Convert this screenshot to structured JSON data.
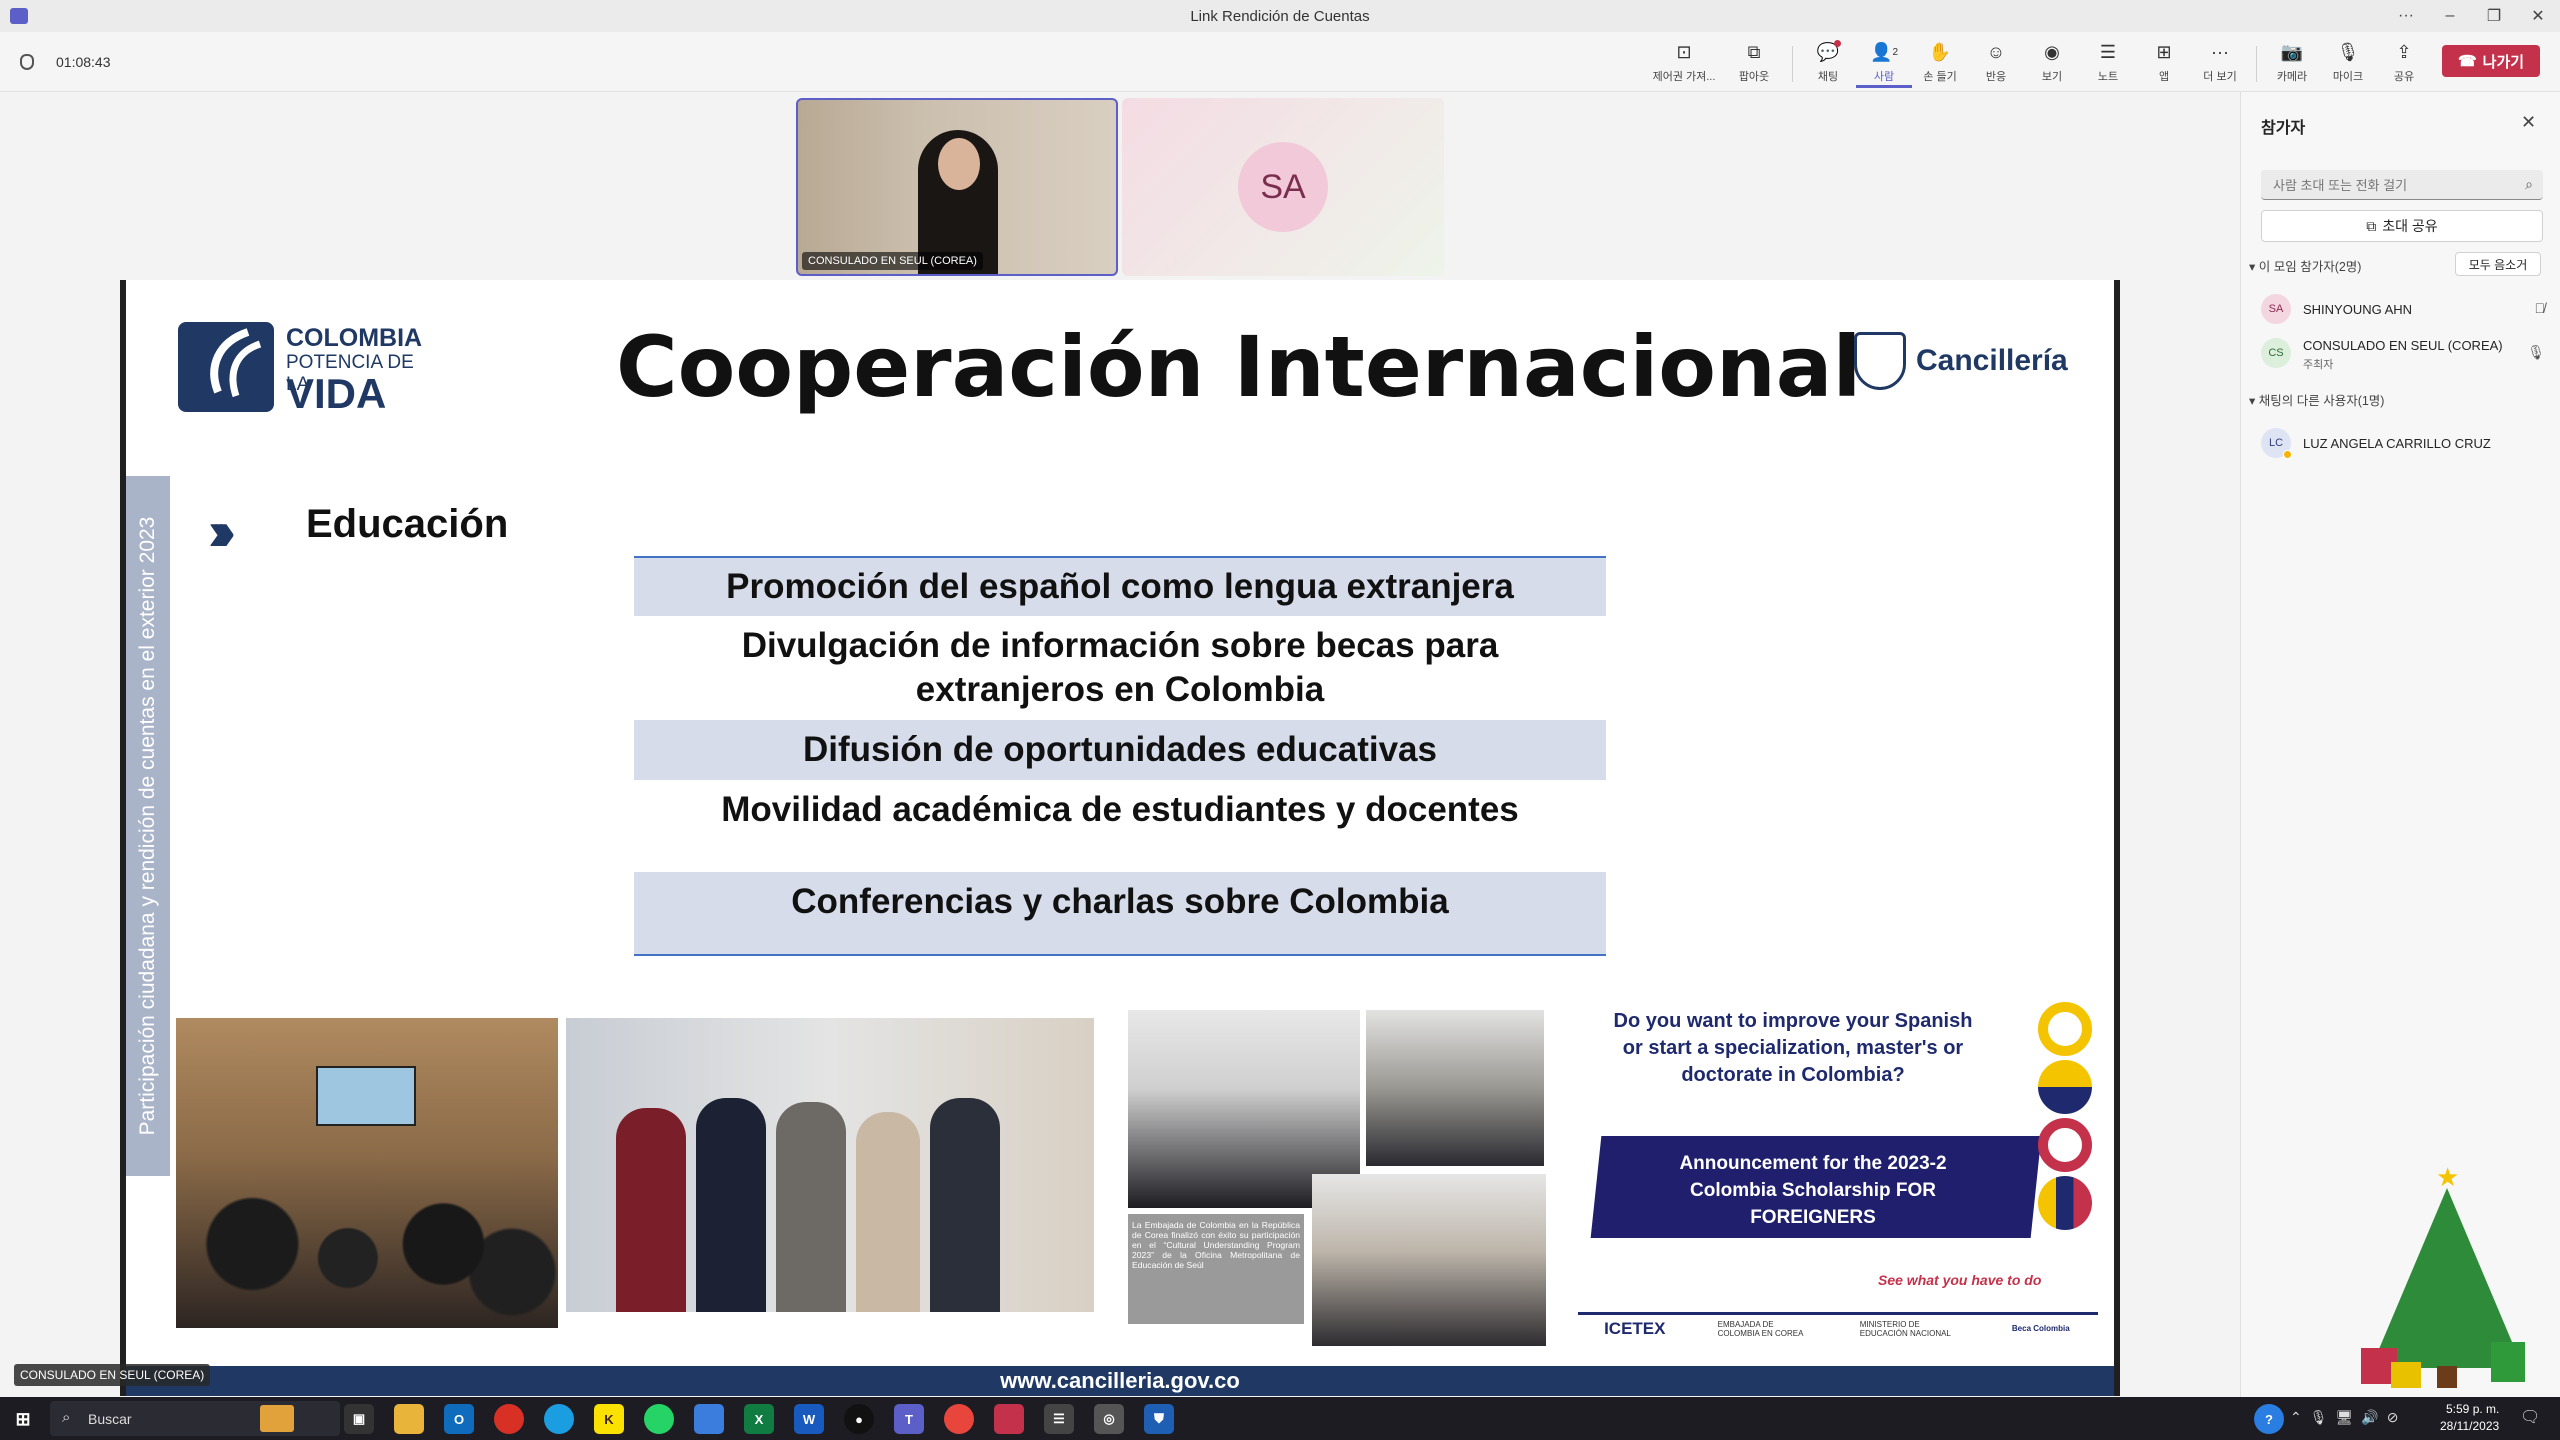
{
  "window": {
    "title": "Link Rendición de Cuentas",
    "more": "···",
    "min": "–",
    "restore": "❐",
    "close": "✕"
  },
  "call": {
    "timer": "01:08:43"
  },
  "toolbar": {
    "items": [
      {
        "label": "제어권 가져...",
        "icon": "⊡"
      },
      {
        "label": "팝아웃",
        "icon": "⧉"
      },
      {
        "label": "채팅",
        "icon": "💬"
      },
      {
        "label": "사람",
        "icon": "👤",
        "badge": "2"
      },
      {
        "label": "손 들기",
        "icon": "✋"
      },
      {
        "label": "반응",
        "icon": "☺"
      },
      {
        "label": "보기",
        "icon": "◉"
      },
      {
        "label": "노트",
        "icon": "☰"
      },
      {
        "label": "앱",
        "icon": "⊞"
      },
      {
        "label": "더 보기",
        "icon": "···"
      },
      {
        "label": "카메라",
        "icon": "📷"
      },
      {
        "label": "마이크",
        "icon": "🎙"
      },
      {
        "label": "공유",
        "icon": "⇪"
      }
    ],
    "leave_label": "나가기"
  },
  "video": {
    "tile1_name": "CONSULADO EN SEUL (COREA)",
    "tile2_initials": "SA",
    "bottom_label": "CONSULADO EN SEUL (COREA)"
  },
  "slide": {
    "logo_line1": "COLOMBIA",
    "logo_line2": "POTENCIA DE LA",
    "logo_line3": "VIDA",
    "title": "Cooperación Internacional",
    "cancilleria": "Cancillería",
    "vertical_text": "Participación ciudadana y rendición de cuentas en el exterior 2023",
    "section": "Educación",
    "items": [
      "Promoción del español como lengua extranjera",
      "Divulgación de información sobre becas para extranjeros en Colombia",
      "Difusión de oportunidades educativas",
      "Movilidad académica de estudiantes y docentes",
      "Conferencias y charlas sobre Colombia"
    ],
    "photo_caption": "La Embajada de Colombia en la República de Corea finalizó con éxito su participación en el “Cultural Understanding Program 2023” de la Oficina Metropolitana de Educación de Seúl",
    "poster": {
      "question": "Do you want to improve your Spanish or start a specialization, master's or doctorate in Colombia?",
      "announcement": "Announcement for the 2023-2 Colombia Scholarship FOR FOREIGNERS",
      "see_what": "See what you have to do",
      "logos": [
        "ICETEX",
        "EMBAJADA DE COLOMBIA EN COREA",
        "MINISTERIO DE EDUCACIÓN NACIONAL",
        "Beca Colombia"
      ]
    },
    "footer_url": "www.cancilleria.gov.co"
  },
  "panel": {
    "title": "참가자",
    "search_placeholder": "사람 초대 또는 전화 걸기",
    "invite_label": "초대 공유",
    "group1_label": "이 모임 참가자(2명)",
    "mute_all": "모두 음소거",
    "participants": [
      {
        "initials": "SA",
        "name": "SHINYOUNG AHN",
        "role": ""
      },
      {
        "initials": "CS",
        "name": "CONSULADO EN SEUL (COREA)",
        "role": "주최자"
      }
    ],
    "group2_label": "채팅의 다른 사용자(1명)",
    "others": [
      {
        "initials": "LC",
        "name": "LUZ ANGELA CARRILLO CRUZ"
      }
    ]
  },
  "taskbar": {
    "search": "Buscar",
    "time": "5:59 p. m.",
    "date": "28/11/2023"
  },
  "colors": {
    "accent": "#5b5fc7",
    "leave": "#c4314b",
    "slide_blue": "#1f3864",
    "band": "#d6dcea"
  }
}
